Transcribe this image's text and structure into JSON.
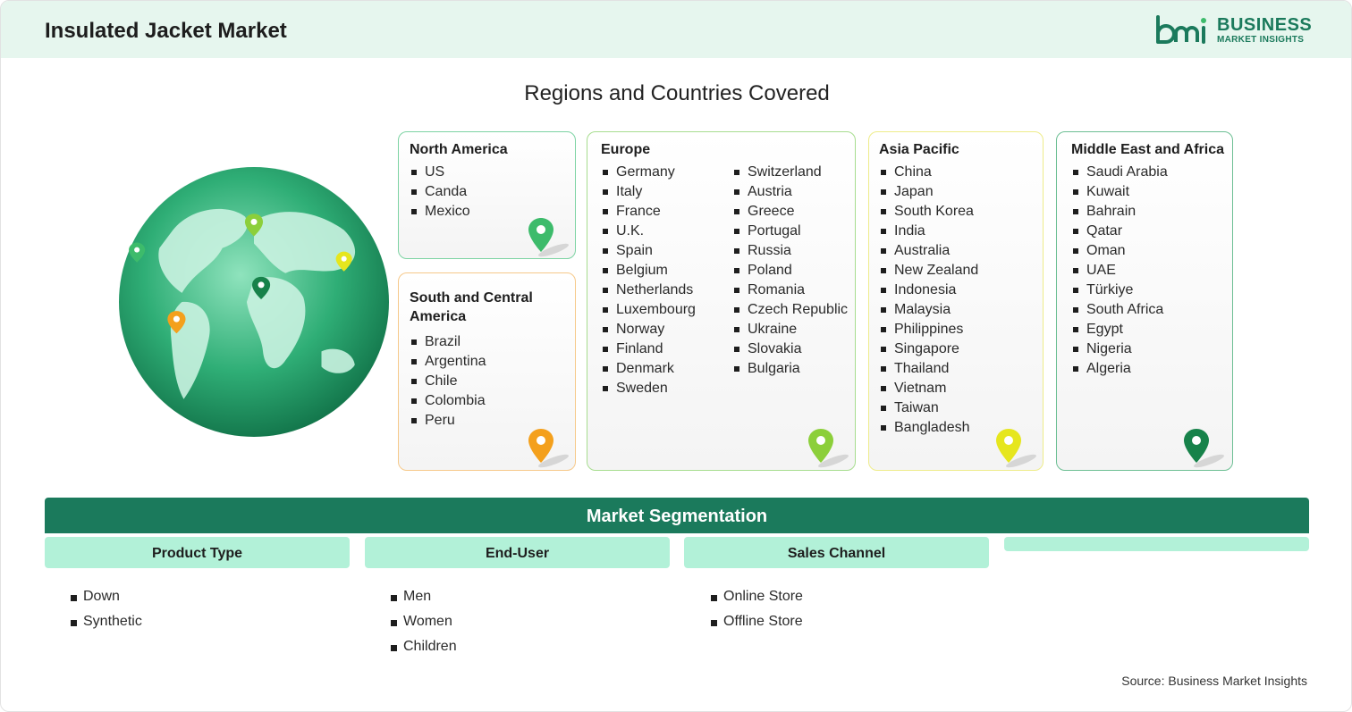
{
  "header": {
    "title": "Insulated Jacket Market"
  },
  "logo": {
    "name": "BUSINESS",
    "tagline": "MARKET INSIGHTS",
    "color": "#1b7a5c"
  },
  "section_title": "Regions and Countries Covered",
  "regions": [
    {
      "name": "North America",
      "accent": "#7dd3a3",
      "pin_color": "#3dbb6b",
      "countries": [
        "US",
        "Canda",
        "Mexico"
      ]
    },
    {
      "name": "South and Central America",
      "accent": "#f6c98a",
      "pin_color": "#f4a01c",
      "countries": [
        "Brazil",
        "Argentina",
        "Chile",
        "Colombia",
        "Peru"
      ]
    },
    {
      "name": "Europe",
      "accent": "#a7dd8f",
      "pin_color": "#8ccf3a",
      "countries": [
        "Germany",
        "Italy",
        "France",
        "U.K.",
        "Spain",
        "Belgium",
        "Netherlands",
        "Luxembourg",
        "Norway",
        "Finland",
        "Denmark",
        "Sweden",
        "Switzerland",
        "Austria",
        "Greece",
        "Portugal",
        "Russia",
        "Poland",
        "Romania",
        "Czech Republic",
        "Ukraine",
        "Slovakia",
        "Bulgaria"
      ]
    },
    {
      "name": "Asia Pacific",
      "accent": "#eeec8a",
      "pin_color": "#e6e61e",
      "countries": [
        "China",
        "Japan",
        "South Korea",
        "India",
        "Australia",
        "New Zealand",
        "Indonesia",
        "Malaysia",
        "Philippines",
        "Singapore",
        "Thailand",
        "Vietnam",
        "Taiwan",
        "Bangladesh"
      ]
    },
    {
      "name": "Middle East and Africa",
      "accent": "#6dbf94",
      "pin_color": "#17824a",
      "countries": [
        "Saudi Arabia",
        "Kuwait",
        "Bahrain",
        "Qatar",
        "Oman",
        "UAE",
        "Türkiye",
        "South Africa",
        "Egypt",
        "Nigeria",
        "Algeria"
      ]
    }
  ],
  "segmentation": {
    "title": "Market Segmentation",
    "columns": [
      {
        "header": "Product Type",
        "items": [
          "Down",
          "Synthetic"
        ]
      },
      {
        "header": "End-User",
        "items": [
          "Men",
          "Women",
          "Children"
        ]
      },
      {
        "header": "Sales Channel",
        "items": [
          "Online Store",
          "Offline Store"
        ]
      },
      {
        "header": "",
        "items": []
      }
    ]
  },
  "source": "Source: Business Market Insights"
}
